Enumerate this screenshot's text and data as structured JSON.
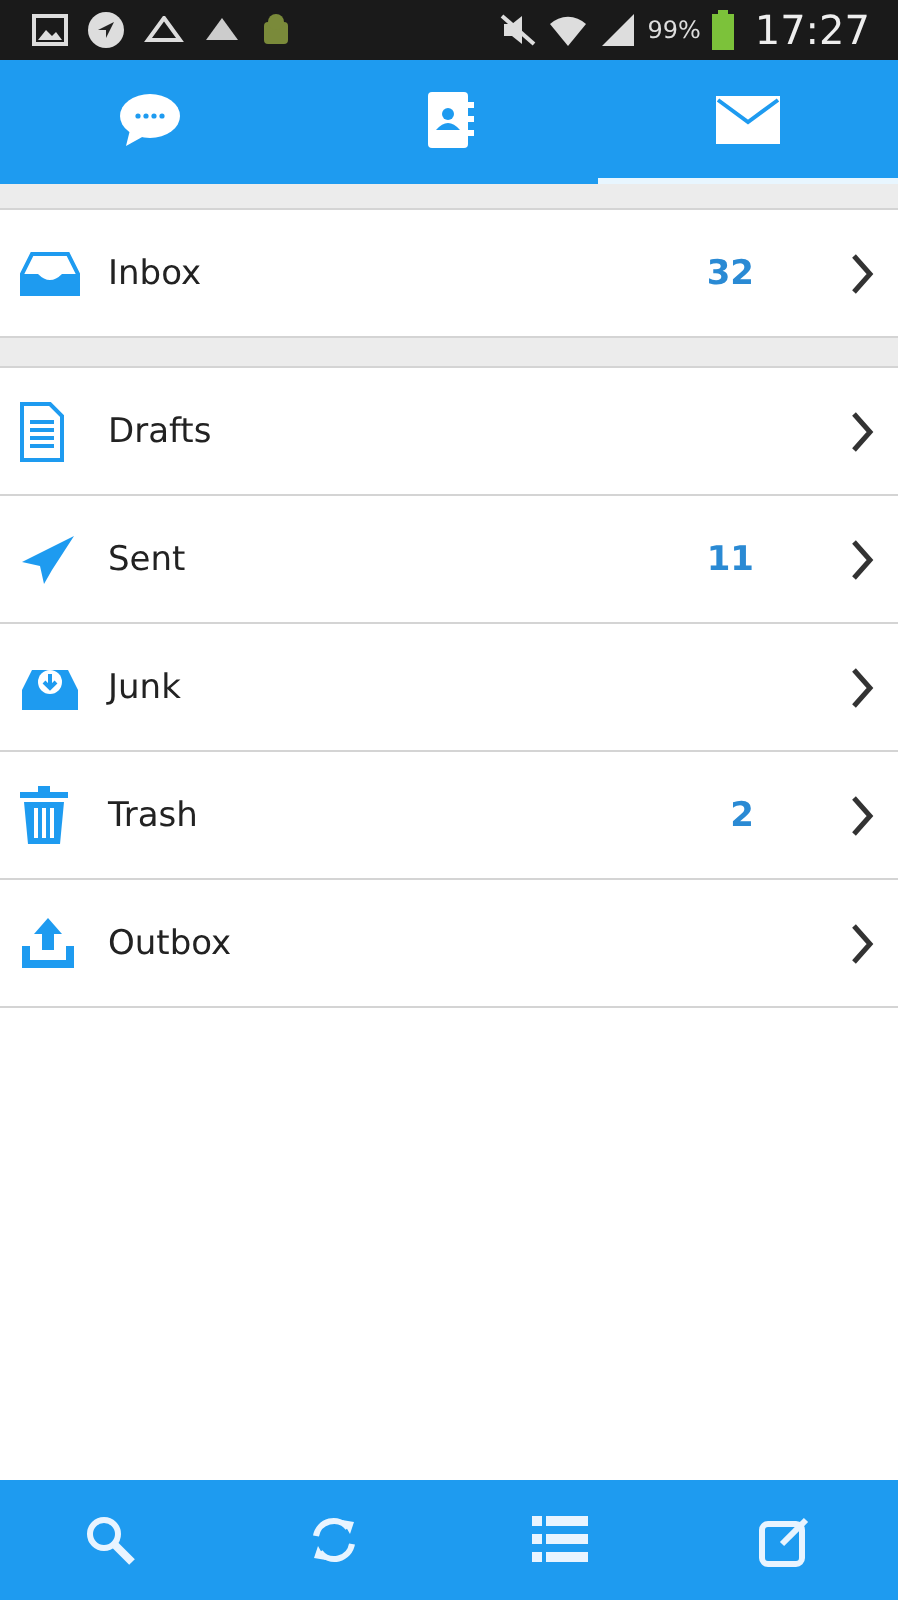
{
  "status_bar": {
    "battery": "99%",
    "time": "17:27"
  },
  "tabs": [
    {
      "kind": "chat",
      "selected": false
    },
    {
      "kind": "contacts",
      "selected": false
    },
    {
      "kind": "mail",
      "selected": true
    }
  ],
  "folder_groups": [
    {
      "folders": [
        {
          "kind": "inbox",
          "label": "Inbox",
          "count": "32"
        }
      ]
    },
    {
      "folders": [
        {
          "kind": "drafts",
          "label": "Drafts"
        },
        {
          "kind": "sent",
          "label": "Sent",
          "count": "11"
        },
        {
          "kind": "junk",
          "label": "Junk"
        },
        {
          "kind": "trash",
          "label": "Trash",
          "count": "2"
        },
        {
          "kind": "outbox",
          "label": "Outbox"
        }
      ]
    }
  ]
}
